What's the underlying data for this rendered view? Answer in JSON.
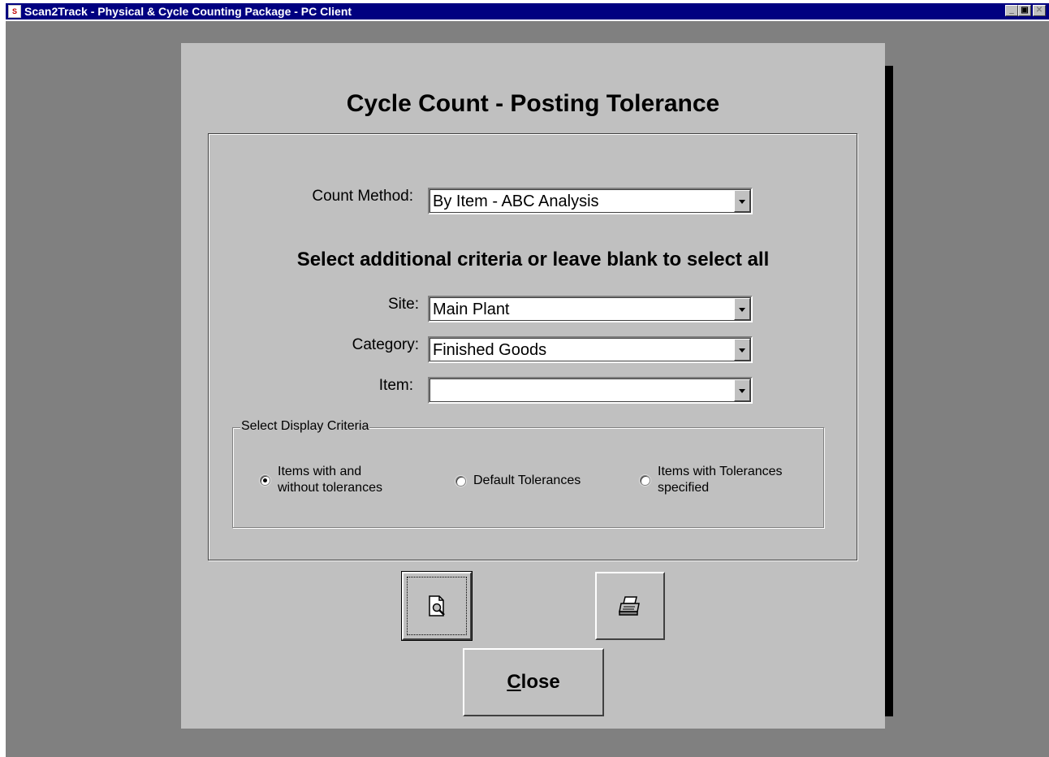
{
  "window": {
    "title": "Scan2Track - Physical & Cycle Counting Package - PC Client",
    "icon": "app-icon",
    "controls": [
      "minimize",
      "restore",
      "close"
    ]
  },
  "form": {
    "heading": "Cycle Count - Posting Tolerance",
    "count_method": {
      "label": "Count Method:",
      "value": "By Item - ABC Analysis"
    },
    "subheading": "Select additional criteria or leave blank to select all",
    "site": {
      "label": "Site:",
      "value": "Main Plant"
    },
    "category": {
      "label": "Category:",
      "value": "Finished Goods"
    },
    "item": {
      "label": "Item:",
      "value": ""
    },
    "display_criteria": {
      "legend": "Select Display Criteria",
      "options": [
        {
          "line1": "Items with and",
          "line2": "without tolerances",
          "checked": true
        },
        {
          "line1": "Default Tolerances",
          "line2": "",
          "checked": false
        },
        {
          "line1": "Items with Tolerances",
          "line2": "specified",
          "checked": false
        }
      ]
    },
    "buttons": {
      "preview_icon": "print-preview-icon",
      "print_icon": "printer-icon",
      "close_label_first": "C",
      "close_label_rest": "lose"
    }
  }
}
